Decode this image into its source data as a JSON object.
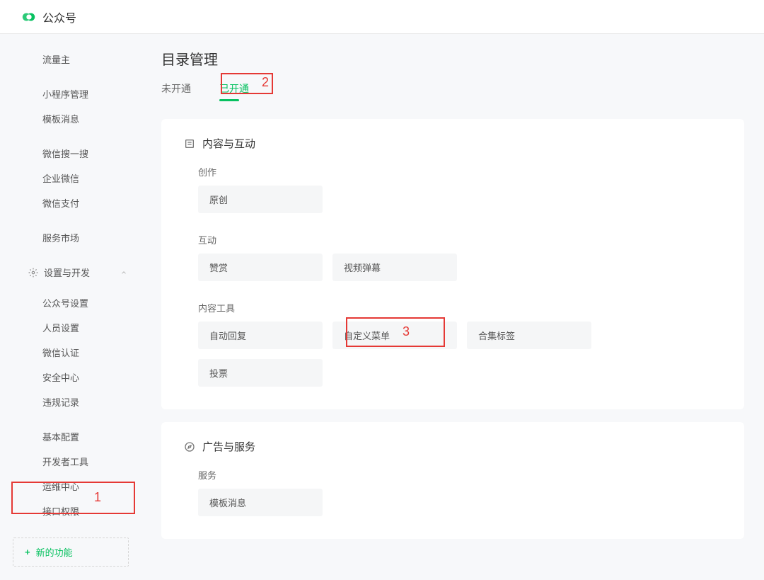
{
  "header": {
    "brand": "公众号"
  },
  "sidebar": {
    "items_top": [
      "流量主",
      "小程序管理",
      "模板消息",
      "微信搜一搜",
      "企业微信",
      "微信支付",
      "服务市场"
    ],
    "section_label": "设置与开发",
    "items_settings": [
      "公众号设置",
      "人员设置",
      "微信认证",
      "安全中心",
      "违规记录",
      "基本配置",
      "开发者工具",
      "运维中心",
      "接口权限"
    ],
    "new_feature": "新的功能"
  },
  "page": {
    "title": "目录管理",
    "tabs": [
      "未开通",
      "已开通"
    ],
    "active_tab": 1
  },
  "panel1": {
    "title": "内容与互动",
    "groups": [
      {
        "label": "创作",
        "tags": [
          "原创"
        ]
      },
      {
        "label": "互动",
        "tags": [
          "赞赏",
          "视频弹幕"
        ]
      },
      {
        "label": "内容工具",
        "tags": [
          "自动回复",
          "自定义菜单",
          "合集标签",
          "投票"
        ]
      }
    ]
  },
  "panel2": {
    "title": "广告与服务",
    "groups": [
      {
        "label": "服务",
        "tags": [
          "模板消息"
        ]
      }
    ]
  },
  "annotations": {
    "a1": "1",
    "a2": "2",
    "a3": "3"
  }
}
